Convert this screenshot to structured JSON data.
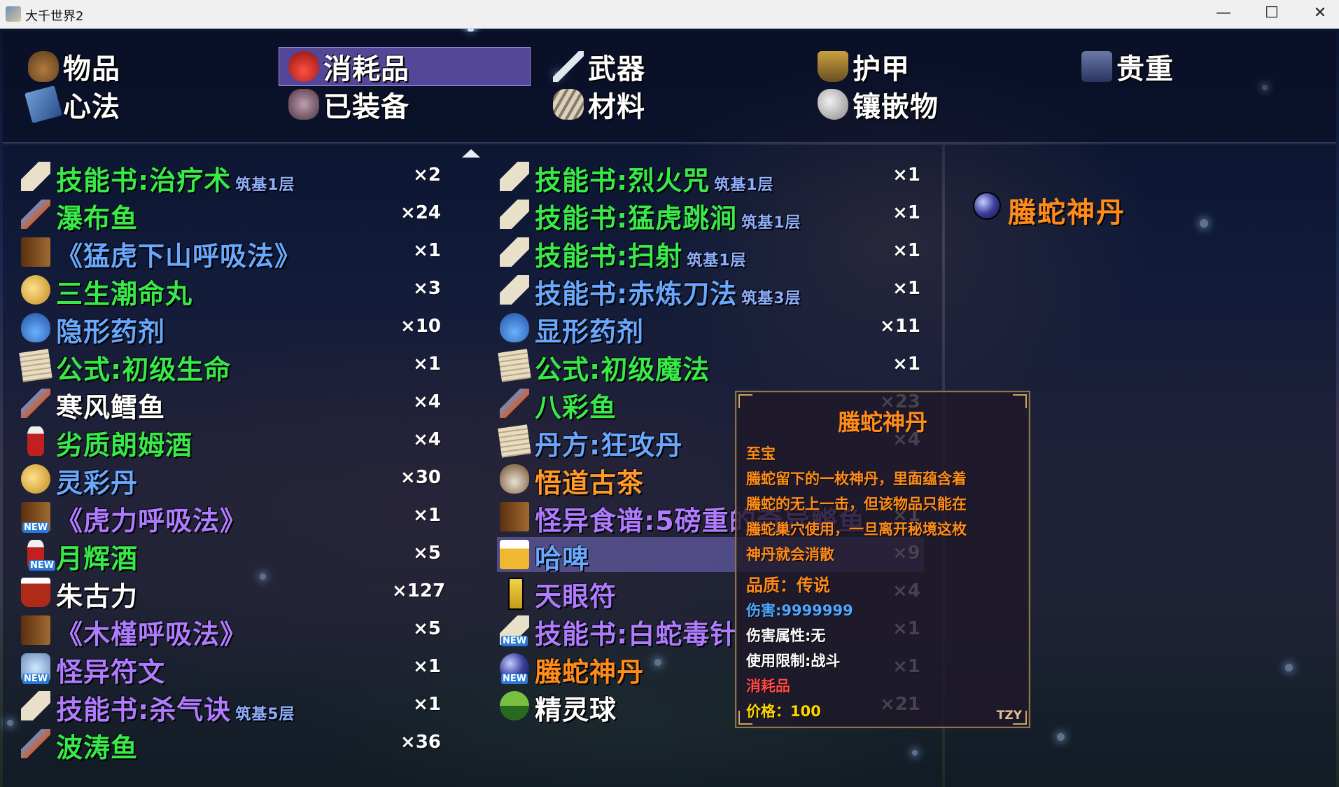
{
  "window": {
    "title": "大千世界2",
    "minimize": "—",
    "maximize": "☐",
    "close": "✕"
  },
  "categories": [
    {
      "label": "物品",
      "icon": "bag-icon"
    },
    {
      "label": "消耗品",
      "icon": "potion-icon",
      "selected": true
    },
    {
      "label": "武器",
      "icon": "sword-icon"
    },
    {
      "label": "护甲",
      "icon": "armor-icon"
    },
    {
      "label": "贵重",
      "icon": "chest-icon"
    },
    {
      "label": "心法",
      "icon": "book-icon"
    },
    {
      "label": "已装备",
      "icon": "equipped-icon"
    },
    {
      "label": "材料",
      "icon": "material-icon"
    },
    {
      "label": "镶嵌物",
      "icon": "gem-icon"
    }
  ],
  "left_items": [
    {
      "name": "技能书:治疗术",
      "tier": "筑基1层",
      "qty": "×2",
      "color": "#39e84a",
      "icon": "scroll-icon"
    },
    {
      "name": "瀑布鱼",
      "qty": "×24",
      "color": "#39e84a",
      "icon": "fish-icon"
    },
    {
      "name": "《猛虎下山呼吸法》",
      "qty": "×1",
      "color": "#6aa8ff",
      "icon": "tome-icon"
    },
    {
      "name": "三生潮命丸",
      "qty": "×3",
      "color": "#39e84a",
      "icon": "pill-icon"
    },
    {
      "name": "隐形药剂",
      "qty": "×10",
      "color": "#6aa8ff",
      "icon": "flask-icon"
    },
    {
      "name": "公式:初级生命",
      "qty": "×1",
      "color": "#39e84a",
      "icon": "paper-icon"
    },
    {
      "name": "寒风鳕鱼",
      "qty": "×4",
      "color": "#ffffff",
      "icon": "fish-icon"
    },
    {
      "name": "劣质朗姆酒",
      "qty": "×4",
      "color": "#39e84a",
      "icon": "bottle-icon"
    },
    {
      "name": "灵彩丹",
      "qty": "×30",
      "color": "#6aa8ff",
      "icon": "pill-icon"
    },
    {
      "name": "《虎力呼吸法》",
      "qty": "×1",
      "color": "#b07cff",
      "icon": "tome-icon",
      "new": true
    },
    {
      "name": "月辉酒",
      "qty": "×5",
      "color": "#39e84a",
      "icon": "bottle-icon",
      "new": true
    },
    {
      "name": "朱古力",
      "qty": "×127",
      "color": "#ffffff",
      "icon": "cup-icon"
    },
    {
      "name": "《木槿呼吸法》",
      "qty": "×5",
      "color": "#b07cff",
      "icon": "tome-icon"
    },
    {
      "name": "怪异符文",
      "qty": "×1",
      "color": "#b07cff",
      "icon": "rune-icon",
      "new": true
    },
    {
      "name": "技能书:杀气诀",
      "tier": "筑基5层",
      "qty": "×1",
      "color": "#b07cff",
      "icon": "scroll-icon"
    },
    {
      "name": "波涛鱼",
      "qty": "×36",
      "color": "#39e84a",
      "icon": "fish-icon"
    }
  ],
  "right_items": [
    {
      "name": "技能书:烈火咒",
      "tier": "筑基1层",
      "qty": "×1",
      "color": "#39e84a",
      "icon": "scroll-icon"
    },
    {
      "name": "技能书:猛虎跳涧",
      "tier": "筑基1层",
      "qty": "×1",
      "color": "#39e84a",
      "icon": "scroll-icon"
    },
    {
      "name": "技能书:扫射",
      "tier": "筑基1层",
      "qty": "×1",
      "color": "#39e84a",
      "icon": "scroll-icon"
    },
    {
      "name": "技能书:赤炼刀法",
      "tier": "筑基3层",
      "qty": "×1",
      "color": "#6aa8ff",
      "icon": "scroll-icon"
    },
    {
      "name": "显形药剂",
      "qty": "×11",
      "color": "#6aa8ff",
      "icon": "flask-icon"
    },
    {
      "name": "公式:初级魔法",
      "qty": "×1",
      "color": "#39e84a",
      "icon": "paper-icon"
    },
    {
      "name": "八彩鱼",
      "qty": "×23",
      "color": "#39e84a",
      "icon": "fish-icon"
    },
    {
      "name": "丹方:狂攻丹",
      "qty": "×4",
      "color": "#6aa8ff",
      "icon": "paper-icon"
    },
    {
      "name": "悟道古茶",
      "qty": "×1",
      "color": "#ff9a2a",
      "icon": "tea-icon"
    },
    {
      "name": "怪异食谱:5磅重的奇异鳉鱼",
      "qty": "×1",
      "color": "#b07cff",
      "icon": "tome-icon"
    },
    {
      "name": "哈啤",
      "qty": "×9",
      "color": "#6aa8ff",
      "icon": "beer-icon"
    },
    {
      "name": "天眼符",
      "qty": "×4",
      "color": "#b07cff",
      "icon": "talisman-icon"
    },
    {
      "name": "技能书:白蛇毒针",
      "qty": "×1",
      "color": "#b07cff",
      "icon": "scroll-icon",
      "new": true
    },
    {
      "name": "螣蛇神丹",
      "qty": "×1",
      "color": "#ff8c1a",
      "icon": "orb-icon",
      "new": true,
      "selected": true
    },
    {
      "name": "精灵球",
      "qty": "×21",
      "color": "#ffffff",
      "icon": "ball-icon"
    }
  ],
  "tooltip": {
    "title": "螣蛇神丹",
    "rarity": "至宝",
    "desc1": "螣蛇留下的一枚神丹，里面蕴含着",
    "desc2": "螣蛇的无上一击，但该物品只能在",
    "desc3": "螣蛇巢穴使用，一旦离开秘境这枚",
    "desc4": "神丹就会消散",
    "quality": "品质：传说",
    "damage": "伤害:9999999",
    "element": "伤害属性:无",
    "usage": "使用限制:战斗",
    "type": "消耗品",
    "price": "价格：100",
    "signature": "TZY"
  },
  "detail": {
    "title": "螣蛇神丹"
  }
}
